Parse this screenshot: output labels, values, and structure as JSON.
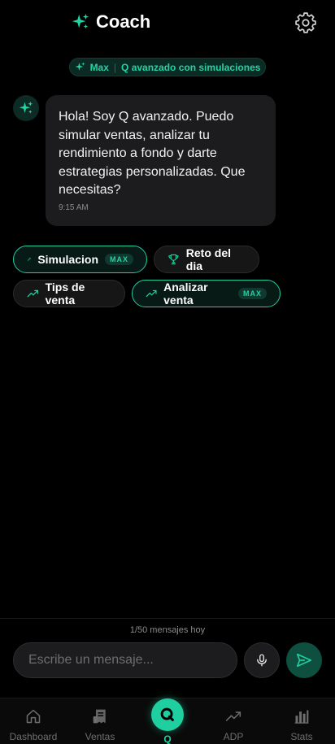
{
  "header": {
    "title": "Coach",
    "logo_icon": "sparkles-icon",
    "settings_icon": "gear-icon"
  },
  "plan_pill": {
    "plan": "Max",
    "separator": "|",
    "description": "Q avanzado con simulaciones"
  },
  "message": {
    "text": "Hola! Soy Q avanzado. Puedo simular ventas, analizar tu rendimiento a fondo y darte estrategias personalizadas. Que necesitas?",
    "time": "9:15 AM",
    "avatar_icon": "sparkles-icon"
  },
  "chips": [
    {
      "label": "Simulacion",
      "icon": "rocket-icon",
      "tag": "MAX"
    },
    {
      "label": "Reto del dia",
      "icon": "trophy-icon"
    },
    {
      "label": "Tips de venta",
      "icon": "trend-icon"
    },
    {
      "label": "Analizar venta",
      "icon": "trend-icon",
      "tag": "MAX"
    }
  ],
  "composer": {
    "counter": "1/50 mensajes hoy",
    "placeholder": "Escribe un mensaje..."
  },
  "tabs": [
    {
      "label": "Dashboard",
      "icon": "home-icon"
    },
    {
      "label": "Ventas",
      "icon": "receipt-icon"
    },
    {
      "label": "Q",
      "icon": "q-logo-icon"
    },
    {
      "label": "ADP",
      "icon": "trend-icon"
    },
    {
      "label": "Stats",
      "icon": "bar-chart-icon"
    }
  ],
  "colors": {
    "accent": "#1fcfa0",
    "background": "#000000",
    "bubble": "#1c1c1e"
  }
}
